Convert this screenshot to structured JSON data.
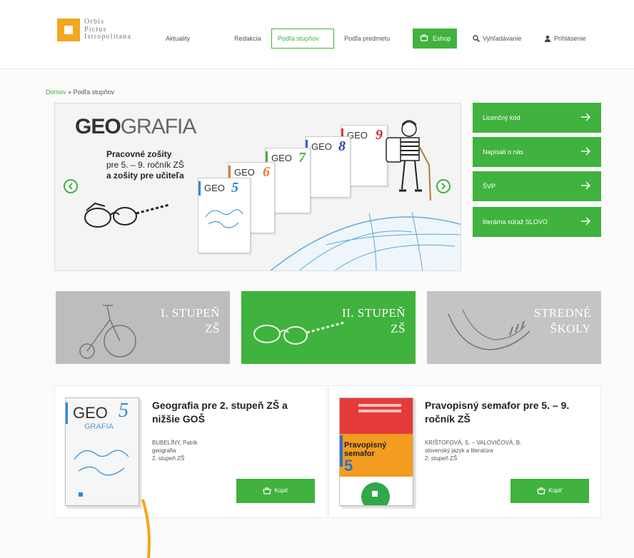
{
  "header": {
    "logo_lines": [
      "Orbis",
      "Pictus",
      "Istropolitana"
    ],
    "nav": {
      "aktuality": "Aktuality",
      "redakcia": "Redakcia",
      "podla_stupnov": "Podľa stupňov",
      "podla_predmetu": "Podľa predmetu",
      "eshop": "Eshop",
      "vyhladavanie": "Vyhľadávanie",
      "prihlasenie": "Prihlásenie"
    }
  },
  "breadcrumb": {
    "home": "Domov",
    "separator": " » ",
    "current": "Podľa stupňov"
  },
  "hero": {
    "title_bold": "GEO",
    "title_light": "GRAFIA",
    "subtitle_lines": [
      "Pracovné zošity",
      "pre 5. – 9. ročník ZŠ",
      "a zošity pre učiteľa"
    ],
    "books": [
      {
        "title": "GEO",
        "grade": "5"
      },
      {
        "title": "GEO",
        "grade": "6"
      },
      {
        "title": "GEO",
        "grade": "7"
      },
      {
        "title": "GEO",
        "grade": "8"
      },
      {
        "title": "GEO",
        "grade": "9"
      }
    ]
  },
  "side_links": [
    "Licenčný kód",
    "Napísali o nás",
    "ŠVP",
    "literárna súťaž SLOVO"
  ],
  "tiles": [
    {
      "line1": "I. STUPEŇ",
      "line2": "ZŠ"
    },
    {
      "line1": "II. STUPEŇ",
      "line2": "ZŠ"
    },
    {
      "line1": "STREDNÉ",
      "line2": "ŠKOLY"
    }
  ],
  "products": [
    {
      "title": "Geografia pre 2. stupeň ZŠ a nižšie GOŠ",
      "author": "BUBELÍNY, Patrik",
      "subject": "geografia",
      "level": "2. stupeň ZŠ",
      "button": "Kúpiť",
      "cover_title": "GEO",
      "cover_sub": "GRAFIA",
      "cover_grade": "5"
    },
    {
      "title": "Pravopisný semafor pre 5. – 9. ročník ZŠ",
      "author": "KRIŠTOFOVÁ, S. – VALOVIČOVÁ, B.",
      "subject": "slovenský jazyk a literatúra",
      "level": "2. stupeň ZŠ",
      "button": "Kúpiť",
      "cover_title": "Pravopisný semafor",
      "cover_grade": "5"
    }
  ],
  "colors": {
    "accent": "#40b23e",
    "logo": "#f3a61f",
    "tile_grey": "#bdbdbd"
  }
}
